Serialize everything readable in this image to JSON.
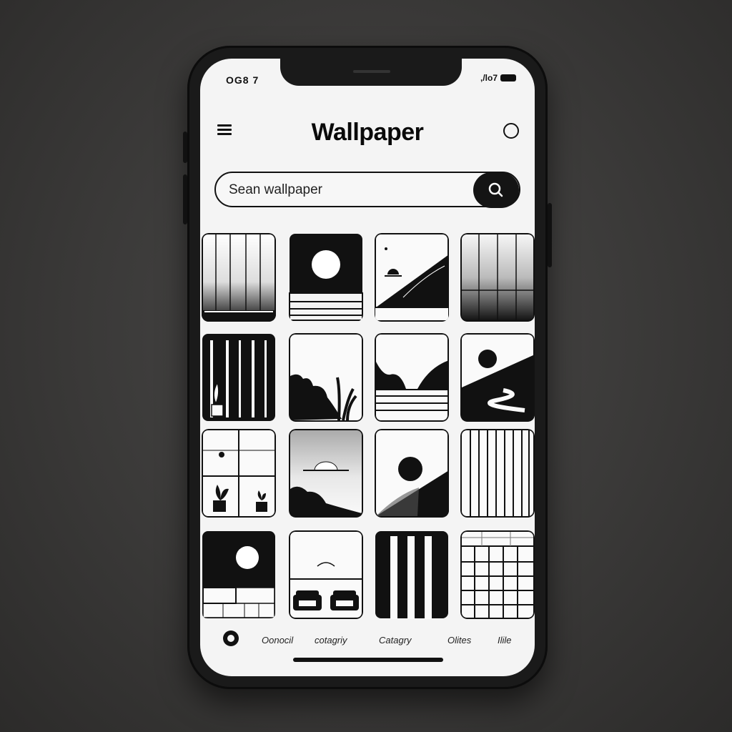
{
  "status_bar": {
    "time": "OG8 7",
    "signal_text": ",/lo7"
  },
  "header": {
    "title": "Wallpaper",
    "menu_icon": "hamburger-icon",
    "profile_icon": "circle-profile-icon"
  },
  "search": {
    "placeholder": "Sean wallpaper",
    "button_icon": "search-icon"
  },
  "gallery": {
    "tiles": [
      "vertical-stripes-grass",
      "moon-over-water",
      "mountain-slope-sun",
      "stripes-gradient",
      "curtain-plant",
      "plants-silhouette",
      "valley-lake",
      "sun-winding-river",
      "window-plants",
      "sunset-gradient",
      "sun-hill",
      "vertical-lines",
      "moon-sofa",
      "couches-room",
      "bold-stripes",
      "grid-tiles"
    ]
  },
  "bottom_nav": {
    "items": [
      "Oonocil",
      "cotagriy",
      "Catagry",
      "Olites",
      "Ilile"
    ]
  },
  "colors": {
    "background": "#3b3a39",
    "phone_body": "#1a1a1a",
    "screen": "#f4f4f4",
    "ink": "#111111"
  }
}
